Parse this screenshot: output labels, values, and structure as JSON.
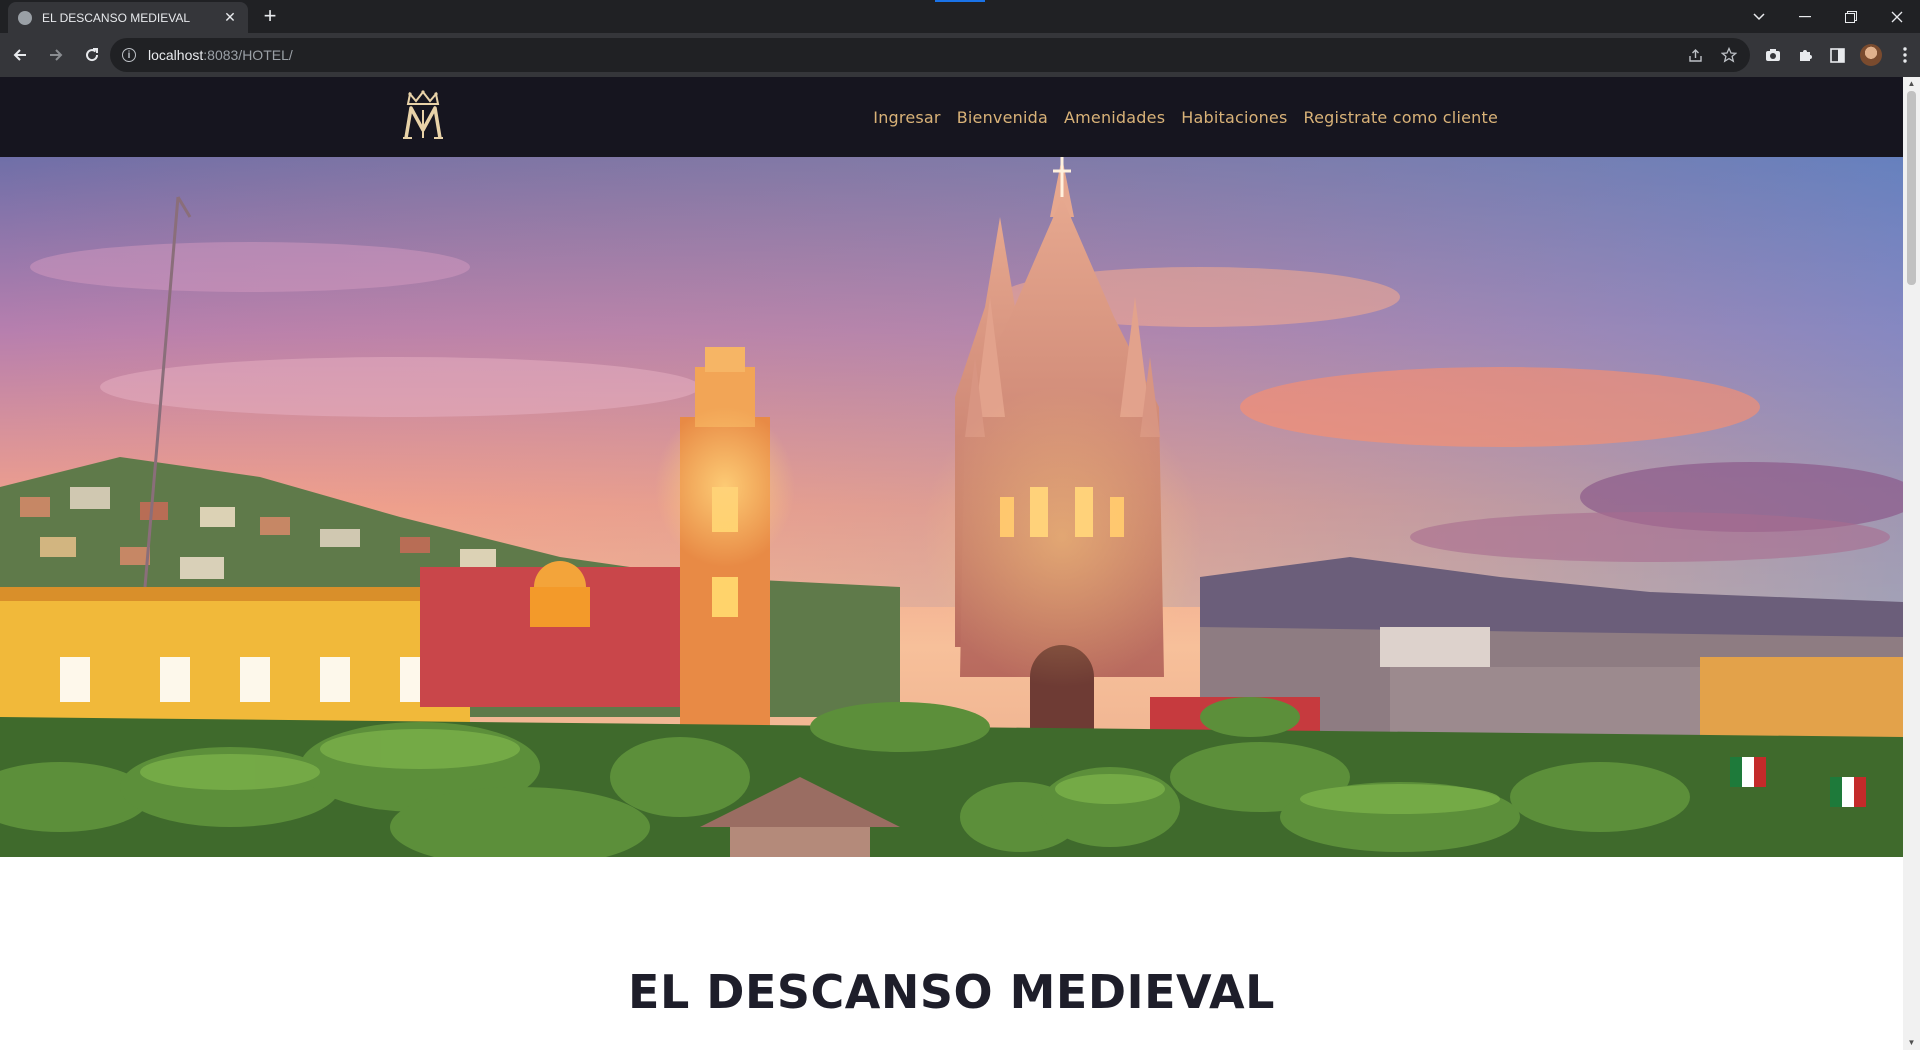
{
  "browser": {
    "tab_title": "EL DESCANSO MEDIEVAL",
    "tab_close": "✕",
    "new_tab": "+",
    "url_host": "localhost",
    "url_path": ":8083/HOTEL/",
    "icons": [
      "back-icon",
      "forward-icon",
      "reload-icon",
      "info-icon",
      "share-icon",
      "star-icon",
      "camera-icon",
      "puzzle-icon",
      "sidebar-icon",
      "profile-avatar",
      "menu-dots-icon"
    ]
  },
  "site": {
    "nav": {
      "items": [
        {
          "label": "Ingresar"
        },
        {
          "label": "Bienvenida"
        },
        {
          "label": "Amenidades"
        },
        {
          "label": "Habitaciones"
        },
        {
          "label": "Registrate como cliente"
        }
      ]
    },
    "content": {
      "title": "EL DESCANSO MEDIEVAL"
    }
  },
  "colors": {
    "header_bg": "#16151f",
    "nav_link": "#d9b278",
    "title_text": "#1e1e2a",
    "chrome_dark": "#202124",
    "chrome_mid": "#35363a"
  }
}
